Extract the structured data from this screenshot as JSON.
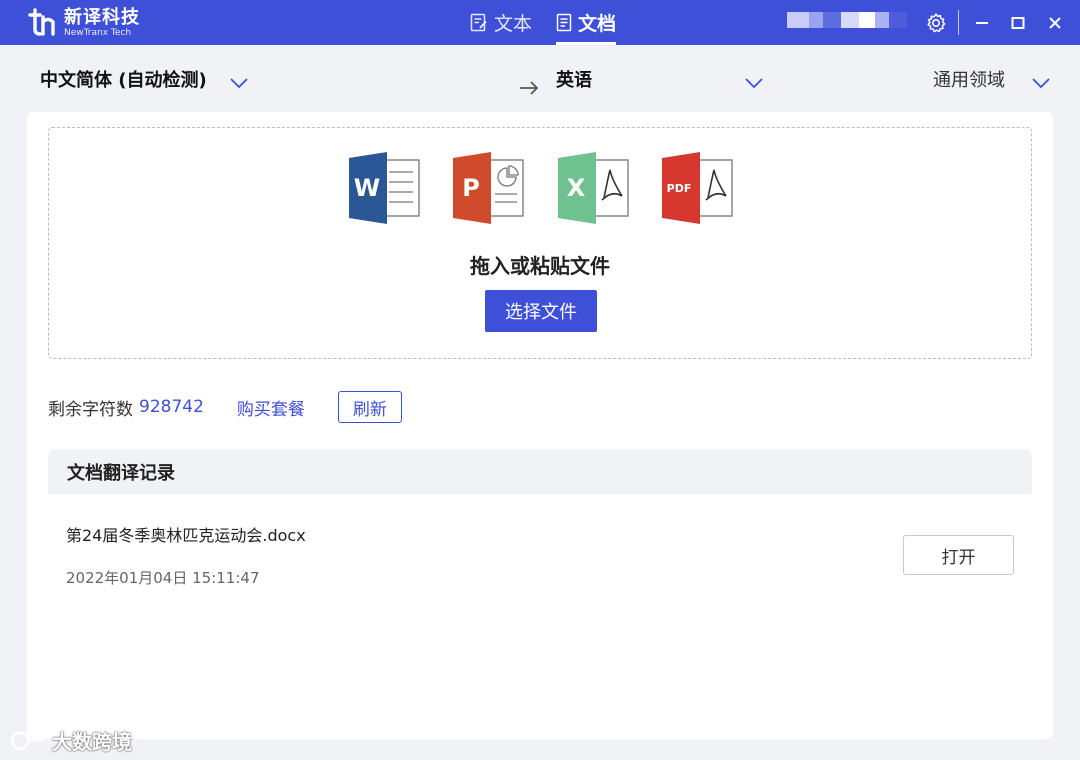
{
  "app": {
    "brand_cn": "新译科技",
    "brand_en": "NewTranx Tech",
    "accent_color": "#3e4fd8"
  },
  "nav": {
    "tabs": [
      {
        "label": "文本",
        "icon": "text-doc-icon",
        "active": false
      },
      {
        "label": "文档",
        "icon": "document-icon",
        "active": true
      }
    ]
  },
  "window_controls": [
    "settings-gear-icon",
    "minimize-icon",
    "maximize-icon",
    "close-icon"
  ],
  "lang": {
    "source": "中文简体 (自动检测)",
    "target": "英语",
    "domain": "通用领域",
    "arrow_icon": "arrow-right-icon",
    "dropdown_icon": "chevron-down-icon"
  },
  "upload": {
    "file_types": [
      {
        "icon": "word-file-icon",
        "letter": "W",
        "color": "#2b5797"
      },
      {
        "icon": "powerpoint-file-icon",
        "letter": "P",
        "color": "#d04a2c"
      },
      {
        "icon": "excel-pdf-file-icon",
        "letter": "X",
        "color": "#6fc28f"
      },
      {
        "icon": "pdf-file-icon",
        "letter": "PDF",
        "color": "#d6372e"
      }
    ],
    "drop_text": "拖入或粘贴文件",
    "select_button": "选择文件"
  },
  "quota": {
    "label": "剩余字符数",
    "value": "928742",
    "buy_link": "购买套餐",
    "refresh_button": "刷新"
  },
  "history": {
    "title": "文档翻译记录",
    "rows": [
      {
        "name": "第24届冬季奥林匹克运动会.docx",
        "time": "2022年01月04日 15:11:47",
        "action": "打开"
      }
    ]
  },
  "watermark": {
    "text": "大数跨境"
  }
}
